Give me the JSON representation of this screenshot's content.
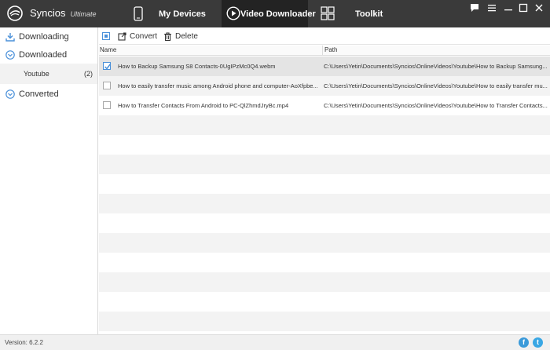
{
  "app": {
    "name": "Syncios",
    "edition": "Ultimate"
  },
  "nav": {
    "my_devices": "My Devices",
    "video_downloader": "Video Downloader",
    "toolkit": "Toolkit"
  },
  "sidebar": {
    "downloading": "Downloading",
    "downloaded": "Downloaded",
    "youtube_label": "Youtube",
    "youtube_count": "(2)",
    "converted": "Converted"
  },
  "toolbar": {
    "convert": "Convert",
    "delete": "Delete"
  },
  "table": {
    "col_name": "Name",
    "col_path": "Path",
    "rows": [
      {
        "checked": true,
        "name": "How to Backup Samsung S8 Contacts-0UgIPzMc0Q4.webm",
        "path": "C:\\Users\\Yetin\\Documents\\Syncios\\OnlineVideos\\Youtube\\How to Backup Samsung..."
      },
      {
        "checked": false,
        "name": "How to easily transfer music among Android phone and computer-AoXfpbe...",
        "path": "C:\\Users\\Yetin\\Documents\\Syncios\\OnlineVideos\\Youtube\\How to easily transfer mu..."
      },
      {
        "checked": false,
        "name": "How to Transfer Contacts From Android to PC-QlZhmdJryBc.mp4",
        "path": "C:\\Users\\Yetin\\Documents\\Syncios\\OnlineVideos\\Youtube\\How to Transfer Contacts..."
      }
    ]
  },
  "status": {
    "version": "Version: 6.2.2"
  },
  "colors": {
    "titlebar": "#3a3a3a",
    "active_tab": "#232323",
    "accent": "#4a90d9",
    "facebook": "#3b9ad9",
    "twitter": "#39a7e4"
  },
  "icons": {
    "logo": "syncios-logo-icon",
    "devices": "phone-icon",
    "video": "play-circle-icon",
    "toolkit": "grid-icon",
    "convert": "convert-icon",
    "delete": "trash-icon"
  }
}
